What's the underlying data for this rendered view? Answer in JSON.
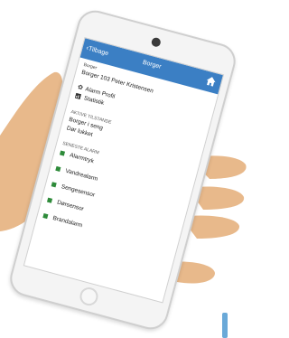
{
  "app": {
    "back_label": "Tilbage",
    "title": "Borger"
  },
  "citizen": {
    "label": "Borger",
    "name": "Borger 103 Peter Kristensen"
  },
  "menu": [
    {
      "icon": "gear-icon",
      "label": "Alarm Profil"
    },
    {
      "icon": "chart-icon",
      "label": "Statistik"
    }
  ],
  "active_states": {
    "heading": "AKTIVE TILSTANDE",
    "items": [
      "Borger i seng",
      "Dør lukket"
    ]
  },
  "latest_alarm": {
    "heading": "SENESTE ALARM",
    "items": [
      "Alarmtryk",
      "Vandrealarm",
      "Sengesensor",
      "Dørsensor",
      "Brandalarm"
    ]
  },
  "colors": {
    "accent": "#3b7fc4",
    "alarm_icon": "#2e8b3a",
    "skin": "#e8b98b"
  }
}
